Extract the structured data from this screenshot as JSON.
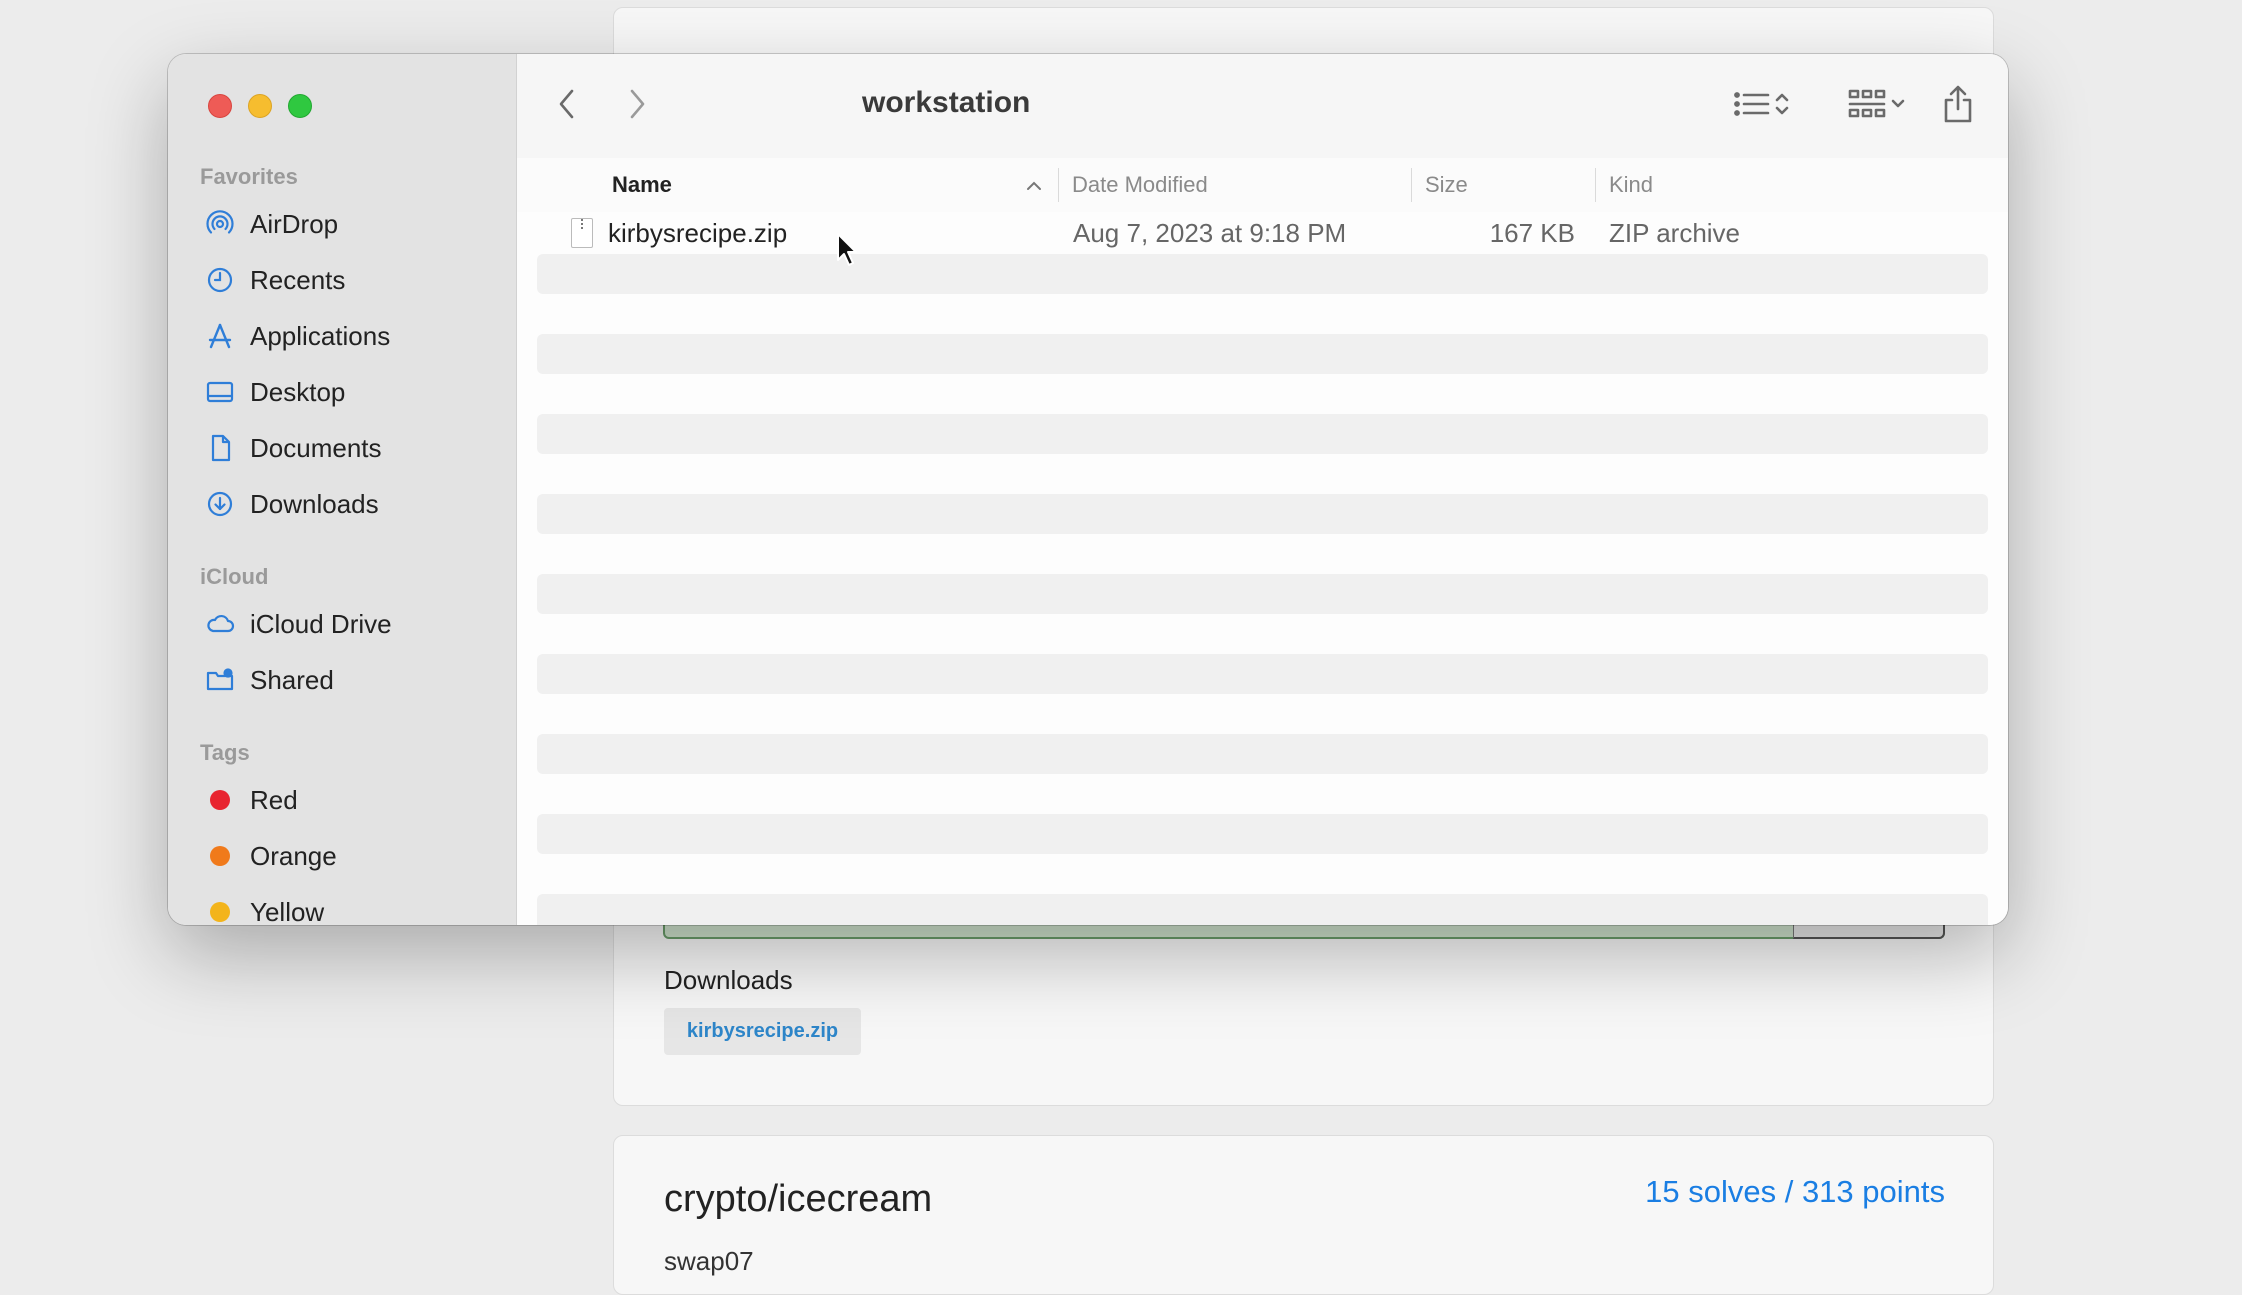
{
  "background_page": {
    "downloads_heading": "Downloads",
    "download_link": "kirbysrecipe.zip",
    "challenge_title": "crypto/icecream",
    "challenge_stats": "15 solves / 313 points",
    "challenge_author": "swap07"
  },
  "finder": {
    "window_title": "workstation",
    "sidebar": {
      "favorites_label": "Favorites",
      "favorites": [
        {
          "label": "AirDrop",
          "icon": "airdrop-icon"
        },
        {
          "label": "Recents",
          "icon": "clock-icon"
        },
        {
          "label": "Applications",
          "icon": "applications-icon"
        },
        {
          "label": "Desktop",
          "icon": "desktop-icon"
        },
        {
          "label": "Documents",
          "icon": "document-icon"
        },
        {
          "label": "Downloads",
          "icon": "download-icon"
        }
      ],
      "icloud_label": "iCloud",
      "icloud": [
        {
          "label": "iCloud Drive",
          "icon": "cloud-icon"
        },
        {
          "label": "Shared",
          "icon": "shared-folder-icon"
        }
      ],
      "tags_label": "Tags",
      "tags": [
        {
          "label": "Red",
          "color": "#e8242f"
        },
        {
          "label": "Orange",
          "color": "#f07a1b"
        },
        {
          "label": "Yellow",
          "color": "#f3b41b"
        }
      ]
    },
    "columns": {
      "name": "Name",
      "date_modified": "Date Modified",
      "size": "Size",
      "kind": "Kind"
    },
    "files": [
      {
        "name": "kirbysrecipe.zip",
        "date_modified": "Aug 7, 2023 at 9:18 PM",
        "size": "167 KB",
        "kind": "ZIP archive"
      }
    ]
  },
  "colors": {
    "accent_blue": "#1a7ee3",
    "sidebar_icon_blue": "#2f7ed8"
  }
}
